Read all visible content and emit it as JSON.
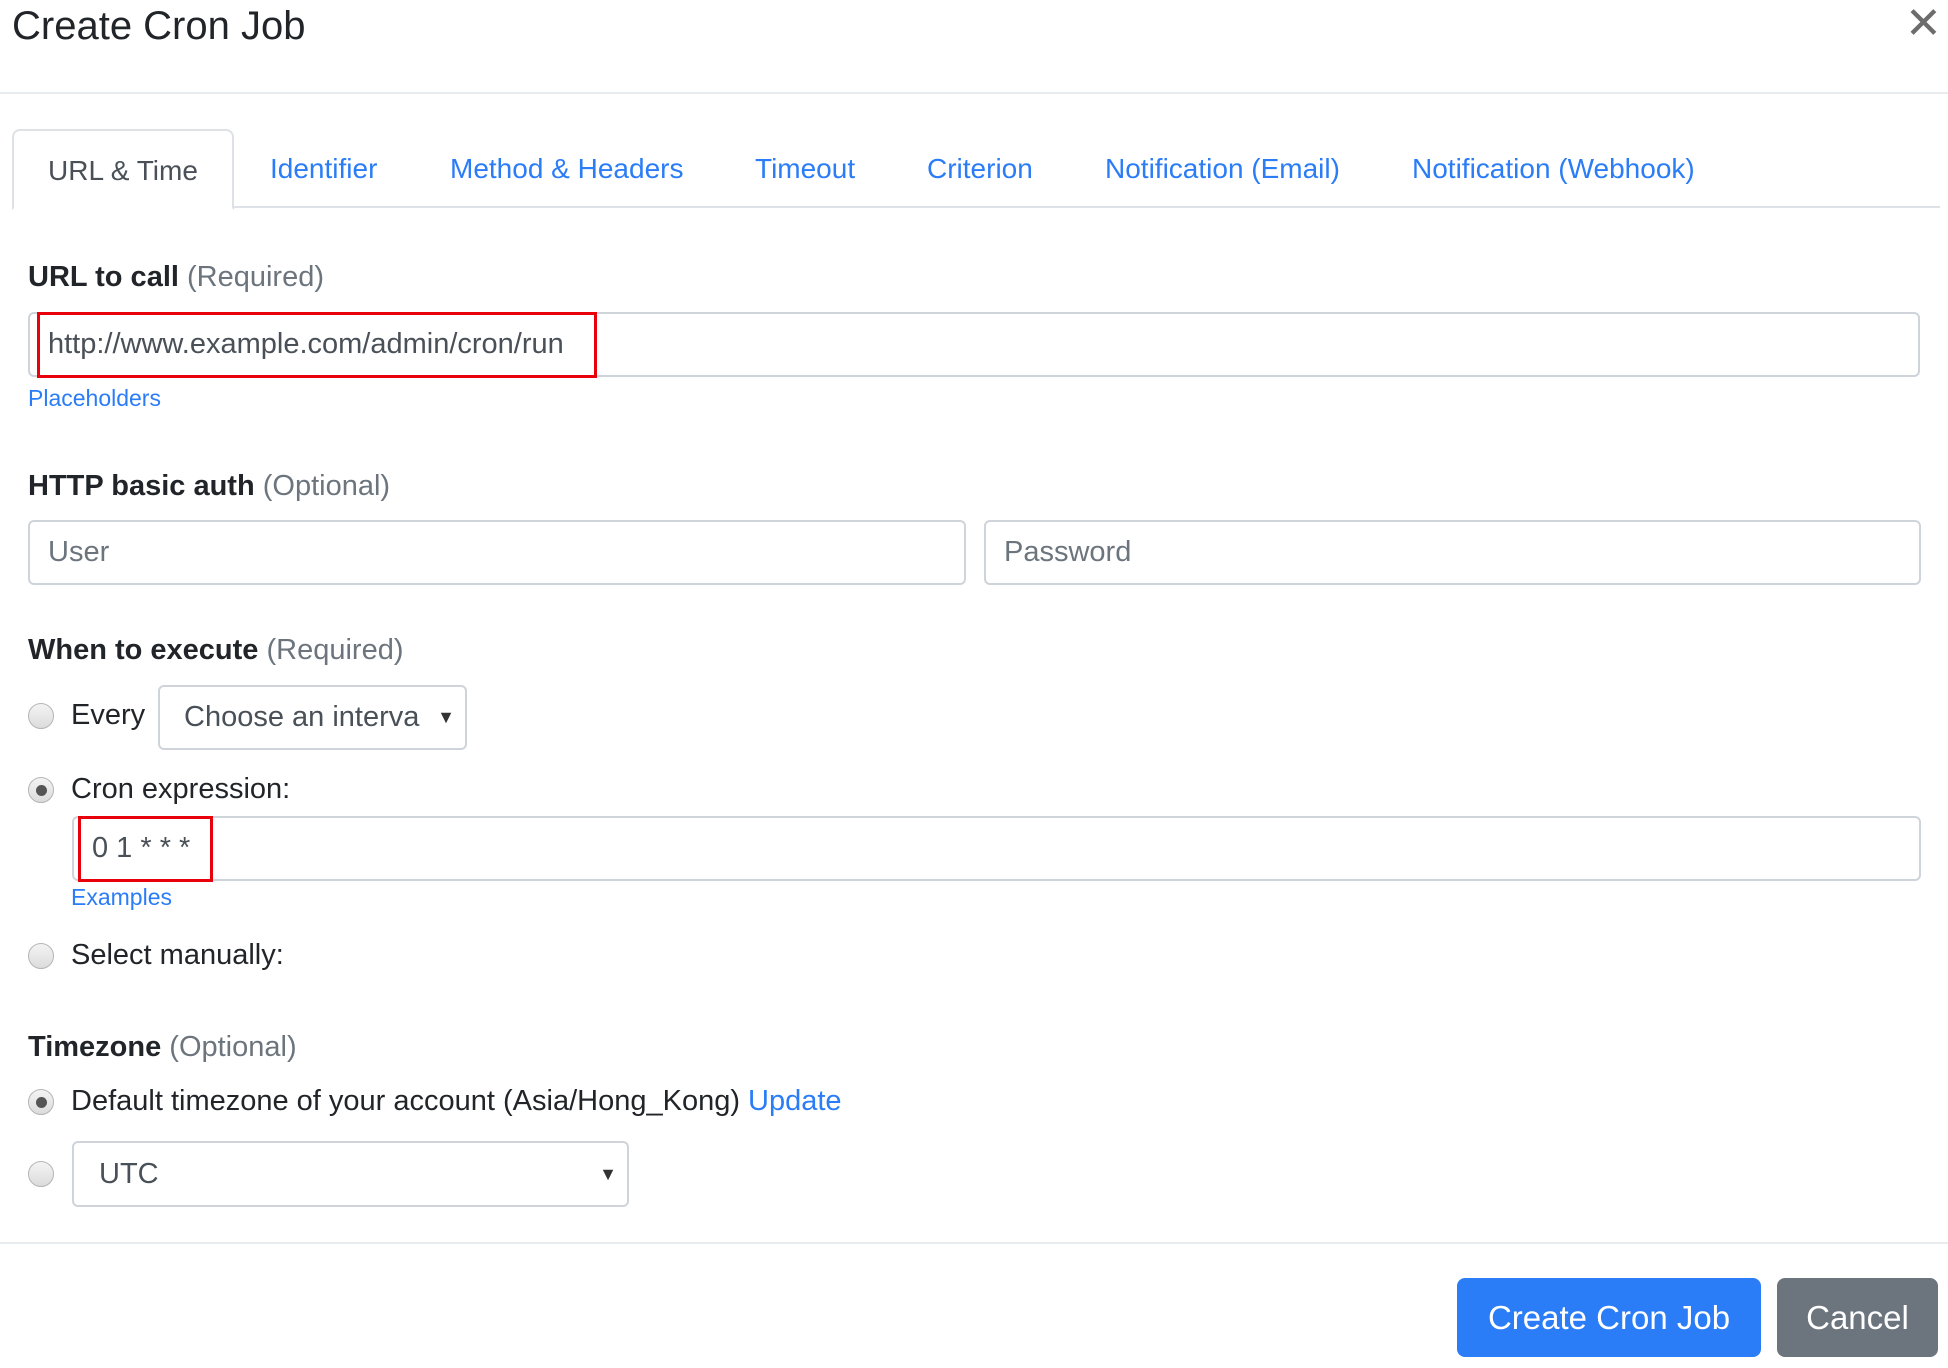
{
  "dialog": {
    "title": "Create Cron Job",
    "close_icon": "close-icon"
  },
  "tabs": [
    {
      "label": "URL & Time",
      "active": true
    },
    {
      "label": "Identifier",
      "active": false
    },
    {
      "label": "Method & Headers",
      "active": false
    },
    {
      "label": "Timeout",
      "active": false
    },
    {
      "label": "Criterion",
      "active": false
    },
    {
      "label": "Notification (Email)",
      "active": false
    },
    {
      "label": "Notification (Webhook)",
      "active": false
    }
  ],
  "url_section": {
    "label": "URL to call",
    "qualifier": "(Required)",
    "value": "http://www.example.com/admin/cron/run",
    "helper_link": "Placeholders"
  },
  "auth_section": {
    "label": "HTTP basic auth",
    "qualifier": "(Optional)",
    "user_placeholder": "User",
    "password_placeholder": "Password"
  },
  "schedule_section": {
    "label": "When to execute",
    "qualifier": "(Required)",
    "options": {
      "every": {
        "label": "Every",
        "checked": false,
        "select_value": "Choose an interval",
        "select_visible_text": "Choose an interva"
      },
      "cron": {
        "label": "Cron expression:",
        "checked": true,
        "value": "0 1 * * *",
        "helper_link": "Examples"
      },
      "manual": {
        "label": "Select manually:",
        "checked": false
      }
    }
  },
  "timezone_section": {
    "label": "Timezone",
    "qualifier": "(Optional)",
    "default_option": {
      "label": "Default timezone of your account (Asia/Hong_Kong)",
      "link": "Update",
      "checked": true
    },
    "custom_option": {
      "checked": false,
      "select_value": "UTC"
    }
  },
  "footer": {
    "create_label": "Create Cron Job",
    "cancel_label": "Cancel"
  },
  "colors": {
    "accent": "#2a7cf7",
    "secondary": "#6c757d",
    "highlight_box": "#e8000b"
  }
}
